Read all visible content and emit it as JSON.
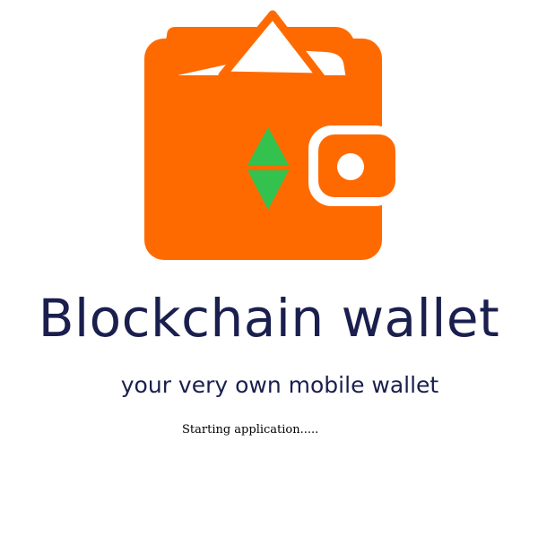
{
  "app": {
    "title": "Blockchain wallet",
    "tagline": "your very own mobile wallet",
    "status": "Starting application....."
  },
  "logo": {
    "icon": "wallet-icon",
    "emblem_icon": "ethereum-diamond-icon"
  },
  "colors": {
    "wallet_orange": "#ff6a00",
    "ethereum_green": "#33c24d",
    "text_navy": "#1a1f4e",
    "background": "#ffffff"
  }
}
